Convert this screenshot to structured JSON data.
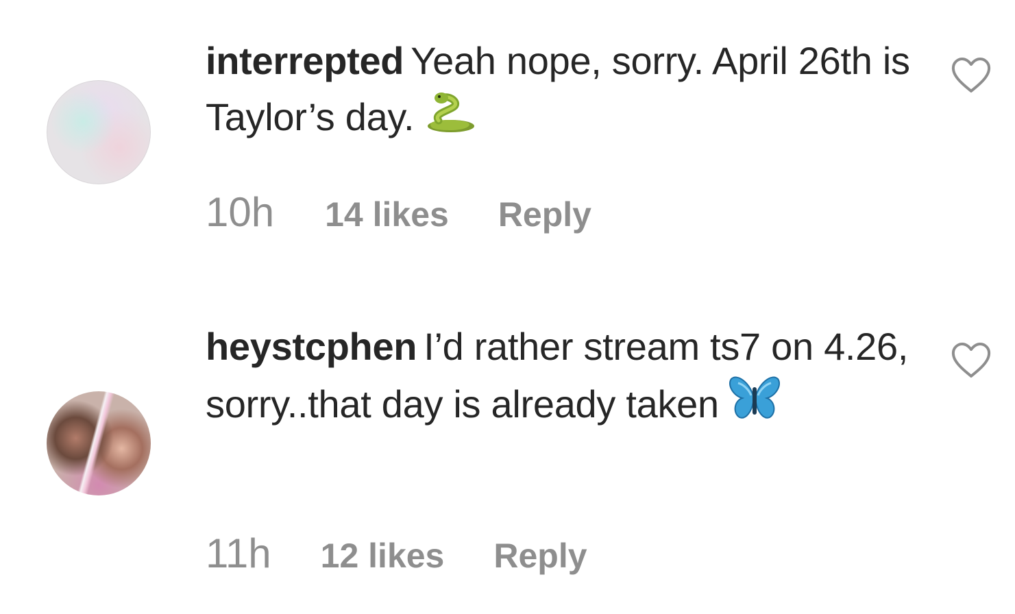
{
  "comments": [
    {
      "username": "interrepted",
      "text": "Yeah nope, sorry. April 26th is Taylor’s day.",
      "emoji": "snake-emoji",
      "time": "10h",
      "likes": "14 likes",
      "reply_label": "Reply",
      "like_icon": "heart-outline-icon"
    },
    {
      "username": "heystcphen",
      "text": "I’d rather stream ts7 on 4.26, sorry..that day is already taken",
      "emoji": "butterfly-emoji",
      "time": "11h",
      "likes": "12 likes",
      "reply_label": "Reply",
      "like_icon": "heart-outline-icon"
    }
  ],
  "colors": {
    "text": "#262626",
    "meta": "#8e8e8e",
    "icon_stroke": "#8e8e8e"
  }
}
